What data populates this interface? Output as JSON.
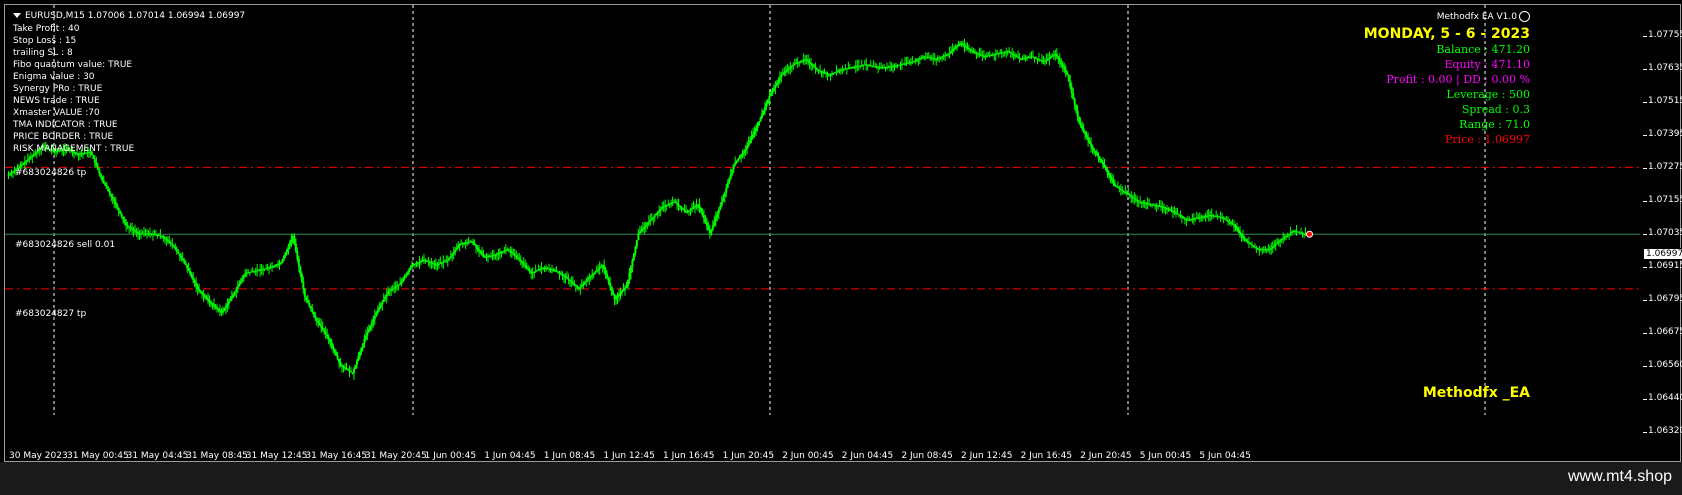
{
  "header": {
    "symbol_line": "EURUSD,M15  1.07006 1.07014 1.06994 1.06997"
  },
  "settings": [
    "Take Profit : 40",
    "Stop Loss : 15",
    "trailing SL : 8",
    "Fibo quantum value: TRUE",
    "Enigma value : 30",
    "Synergy PRo : TRUE",
    "NEWS trade : TRUE",
    "Xmaster VALUE :70",
    "TMA INDICATOR : TRUE",
    "PRICE BORDER : TRUE",
    "RISK MANAGEMENT : TRUE"
  ],
  "orders": {
    "tp_upper": "#683024826 tp",
    "entry": "#683024826 sell 0.01",
    "tp_lower": "#683024827 tp"
  },
  "ea_panel": {
    "title": "Methodfx EA V1.0",
    "date": "MONDAY, 5 - 6 - 2023",
    "rows": [
      {
        "text": "Balance  : 471.20",
        "color": "#00ff00"
      },
      {
        "text": "Equity    : 471.10",
        "color": "#ff00ff"
      },
      {
        "text": "Profit : 0.00 | DD : 0.00 %",
        "color": "#ff00ff"
      },
      {
        "text": "Leverage  : 500",
        "color": "#00ff00"
      },
      {
        "text": "Spread  : 0.3",
        "color": "#00ff00"
      },
      {
        "text": "Range : 71.0",
        "color": "#00ff00"
      },
      {
        "text": "Price : 1.06997",
        "color": "#ff0000"
      }
    ]
  },
  "brand": "Methodfx _EA",
  "current_price": "1.06997",
  "price_ticks": [
    "1.07755",
    "1.07635",
    "1.07515",
    "1.07395",
    "1.07275",
    "1.07155",
    "1.07035",
    "1.06915",
    "1.06795",
    "1.06675",
    "1.06560",
    "1.06440",
    "1.06320"
  ],
  "time_ticks": [
    "30 May 2023",
    "31 May 00:45",
    "31 May 04:45",
    "31 May 08:45",
    "31 May 12:45",
    "31 May 16:45",
    "31 May 20:45",
    "1 Jun 00:45",
    "1 Jun 04:45",
    "1 Jun 08:45",
    "1 Jun 12:45",
    "1 Jun 16:45",
    "1 Jun 20:45",
    "2 Jun 00:45",
    "2 Jun 04:45",
    "2 Jun 08:45",
    "2 Jun 12:45",
    "2 Jun 16:45",
    "2 Jun 20:45",
    "5 Jun 00:45",
    "5 Jun 04:45"
  ],
  "footer": "www.mt4.shop",
  "colors": {
    "candles": "#00ff00",
    "tp_line": "#ff0000",
    "entry_line": "#2e8b57",
    "grid": "#ffffff"
  },
  "chart_data": {
    "type": "candlestick",
    "symbol": "EURUSD",
    "timeframe": "M15",
    "ylim": [
      1.0632,
      1.0785
    ],
    "levels": {
      "tp_upper": 1.0725,
      "entry": 1.06997,
      "tp_lower": 1.0679
    },
    "close_series": [
      1.0722,
      1.0725,
      1.0729,
      1.0733,
      1.0731,
      1.0732,
      1.073,
      1.0731,
      1.072,
      1.0712,
      1.0703,
      1.07,
      1.07,
      1.0699,
      1.0695,
      1.0688,
      1.0679,
      1.0674,
      1.067,
      1.0677,
      1.0685,
      1.0686,
      1.0687,
      1.0689,
      1.0699,
      1.0676,
      1.0667,
      1.066,
      1.065,
      1.0647,
      1.066,
      1.067,
      1.0678,
      1.0681,
      1.0688,
      1.069,
      1.0688,
      1.069,
      1.0696,
      1.0697,
      1.0691,
      1.0692,
      1.0694,
      1.069,
      1.0685,
      1.0687,
      1.0686,
      1.0683,
      1.0679,
      1.0684,
      1.0688,
      1.0675,
      1.068,
      1.07,
      1.0705,
      1.071,
      1.0712,
      1.0708,
      1.0711,
      1.07,
      1.0712,
      1.0726,
      1.0732,
      1.0741,
      1.0752,
      1.076,
      1.0764,
      1.0766,
      1.0762,
      1.076,
      1.0762,
      1.0763,
      1.0764,
      1.0763,
      1.0763,
      1.0764,
      1.0765,
      1.0767,
      1.0766,
      1.0768,
      1.0772,
      1.0769,
      1.0767,
      1.0768,
      1.0769,
      1.0766,
      1.0767,
      1.0765,
      1.0768,
      1.076,
      1.0742,
      1.0733,
      1.0726,
      1.0718,
      1.0715,
      1.0712,
      1.0711,
      1.071,
      1.0708,
      1.0705,
      1.0706,
      1.0707,
      1.0706,
      1.0703,
      1.0697,
      1.0694,
      1.0694,
      1.0698,
      1.0701,
      1.06997
    ]
  }
}
